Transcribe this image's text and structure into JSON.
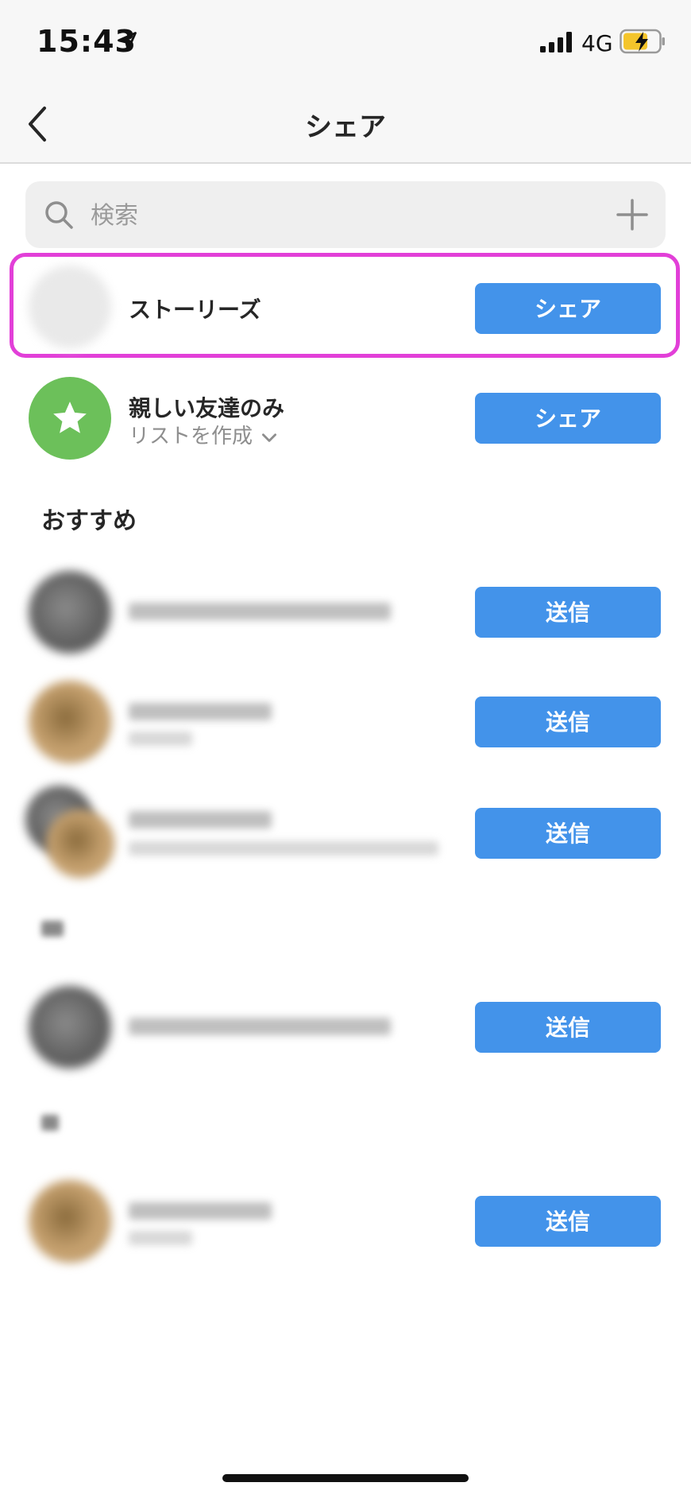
{
  "status_bar": {
    "time": "15:43",
    "network": "4G",
    "icons": [
      "location-arrow-icon",
      "signal-bars-icon",
      "battery-charging-icon"
    ]
  },
  "nav": {
    "title": "シェア",
    "back_icon": "chevron-left-icon"
  },
  "search": {
    "placeholder": "検索",
    "value": "",
    "add_icon": "plus-icon"
  },
  "share_rows": [
    {
      "name": "ストーリーズ",
      "button": "シェア",
      "highlighted": true
    },
    {
      "name": "親しい友達のみ",
      "sub": "リストを作成",
      "button": "シェア",
      "icon": "star-icon"
    }
  ],
  "suggested": {
    "header": "おすすめ",
    "rows": [
      {
        "button": "送信"
      },
      {
        "button": "送信"
      },
      {
        "button": "送信"
      }
    ]
  },
  "section_h": {
    "rows": [
      {
        "button": "送信"
      }
    ]
  },
  "section_r": {
    "rows": [
      {
        "button": "送信"
      }
    ]
  },
  "colors": {
    "accent_button": "#4393ea",
    "highlight_border": "#e23fd8",
    "close_friends": "#6cc05a"
  }
}
